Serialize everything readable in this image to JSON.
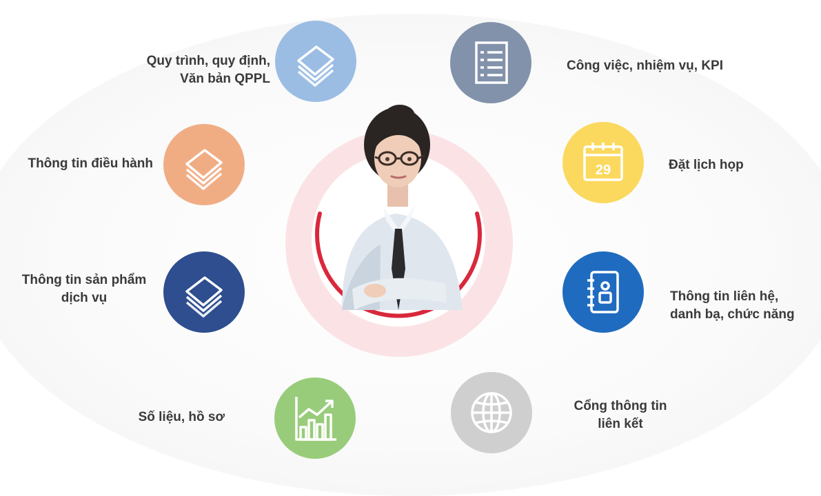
{
  "items": [
    {
      "lines": [
        "Quy trình, quy định,",
        "Văn bản QPPL"
      ],
      "icon": "document-stack-icon",
      "color": "#9bbde4"
    },
    {
      "lines": [
        "Công việc, nhiệm vụ, KPI"
      ],
      "icon": "list-document-icon",
      "color": "#8292ab"
    },
    {
      "lines": [
        "Thông tin điều hành"
      ],
      "icon": "document-stack-icon",
      "color": "#f0ad84"
    },
    {
      "lines": [
        "Đặt lịch họp"
      ],
      "icon": "calendar-icon",
      "color": "#fbd95e",
      "calendar_day": "29"
    },
    {
      "lines": [
        "Thông tin sản phẩm",
        "dịch vụ"
      ],
      "icon": "document-stack-icon",
      "color": "#2e4e8f"
    },
    {
      "lines": [
        "Thông tin liên hệ,",
        "danh bạ, chức năng"
      ],
      "icon": "contact-book-icon",
      "color": "#1f6bc0"
    },
    {
      "lines": [
        "Số liệu, hồ sơ"
      ],
      "icon": "bar-chart-trend-icon",
      "color": "#98cc7a"
    },
    {
      "lines": [
        "Cổng thông tin",
        "liên kết"
      ],
      "icon": "globe-icon",
      "color": "#cfcfcf"
    }
  ],
  "center": {
    "icon": "assistant-avatar",
    "ring_color": "#d9283c"
  }
}
